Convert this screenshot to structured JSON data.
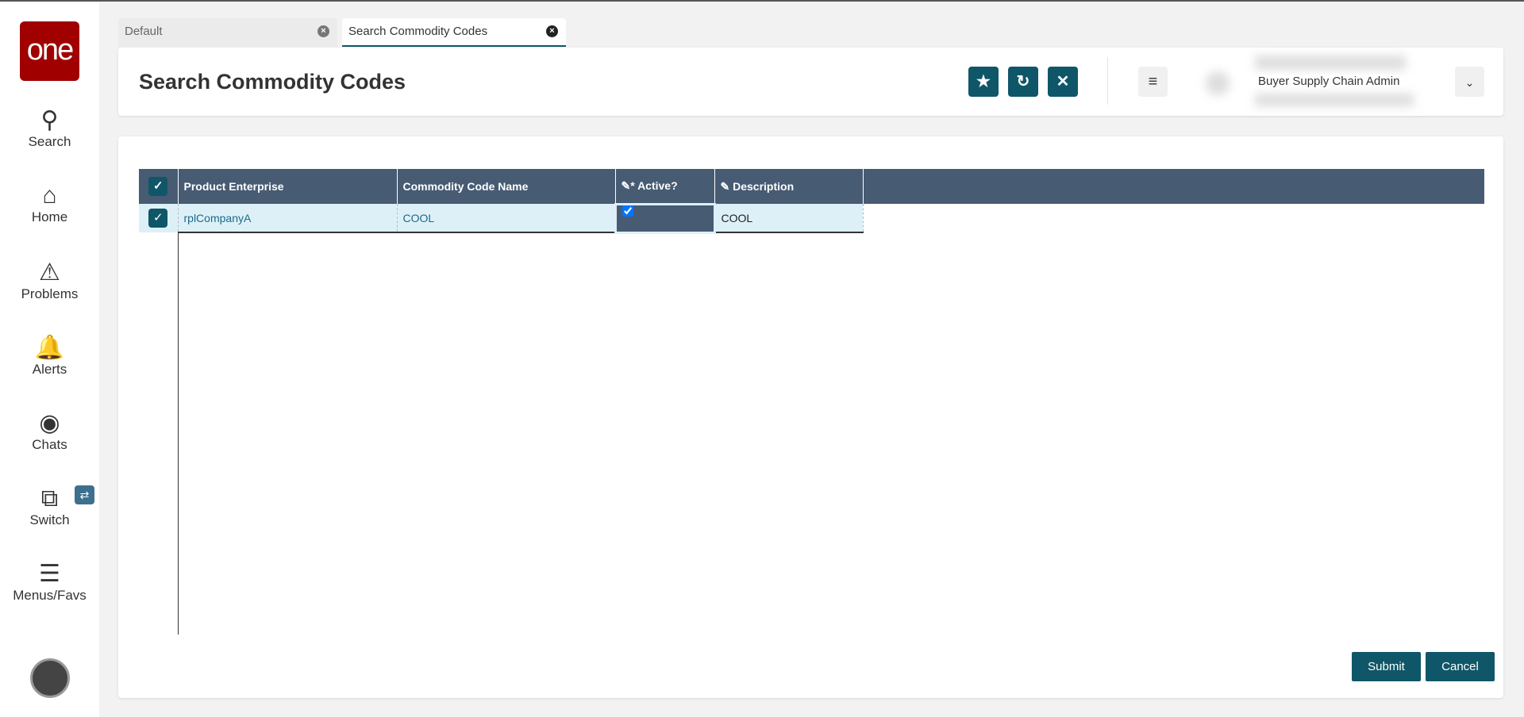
{
  "sidebar": {
    "logo": "one",
    "items": [
      {
        "label": "Search"
      },
      {
        "label": "Home"
      },
      {
        "label": "Problems"
      },
      {
        "label": "Alerts"
      },
      {
        "label": "Chats"
      },
      {
        "label": "Switch"
      },
      {
        "label": "Menus/Favs"
      }
    ]
  },
  "tabs": [
    {
      "label": "Default"
    },
    {
      "label": "Search Commodity Codes"
    }
  ],
  "header": {
    "title": "Search Commodity Codes",
    "role": "Buyer Supply Chain Admin"
  },
  "table": {
    "columns": [
      "Product Enterprise",
      "Commodity Code Name",
      "Active?",
      "Description"
    ],
    "rows": [
      {
        "enterprise": "rplCompanyA",
        "code": "COOL",
        "active": true,
        "description": "COOL"
      }
    ]
  },
  "footer": {
    "submit": "Submit",
    "cancel": "Cancel"
  }
}
